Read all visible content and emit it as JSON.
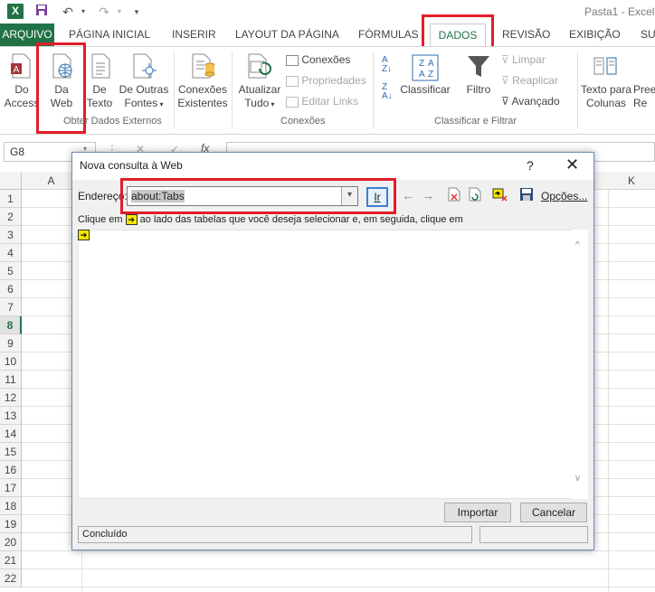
{
  "titlebar": {
    "app_title": "Pasta1 - Excel",
    "qat": [
      "save-icon",
      "undo-icon",
      "redo-icon",
      "customize-qat-icon"
    ]
  },
  "ribbon": {
    "tabs": [
      {
        "id": "arquivo",
        "label": "ARQUIVO"
      },
      {
        "id": "pagina-inicial",
        "label": "PÁGINA INICIAL"
      },
      {
        "id": "inserir",
        "label": "INSERIR"
      },
      {
        "id": "layout",
        "label": "LAYOUT DA PÁGINA"
      },
      {
        "id": "formulas",
        "label": "FÓRMULAS"
      },
      {
        "id": "dados",
        "label": "DADOS"
      },
      {
        "id": "revisao",
        "label": "REVISÃO"
      },
      {
        "id": "exibicao",
        "label": "EXIBIÇÃO"
      },
      {
        "id": "su",
        "label": "SU"
      }
    ],
    "active_tab": "DADOS",
    "groups": {
      "external": {
        "label": "Obter Dados Externos",
        "access": [
          "Do",
          "Access"
        ],
        "web": [
          "Da",
          "Web"
        ],
        "text": [
          "De",
          "Texto"
        ],
        "other": [
          "De Outras",
          "Fontes"
        ]
      },
      "existing": {
        "label": [
          "Conexões",
          "Existentes"
        ]
      },
      "connections": {
        "label": "Conexões",
        "refresh": [
          "Atualizar",
          "Tudo"
        ],
        "items": [
          "Conexões",
          "Propriedades",
          "Editar Links"
        ]
      },
      "sort": {
        "label": "Classificar e Filtrar",
        "sort": "Classificar",
        "filter": "Filtro",
        "items": [
          "Limpar",
          "Reaplicar",
          "Avançado"
        ]
      },
      "tools": {
        "text_cols": [
          "Texto para",
          "Colunas"
        ],
        "pree": [
          "Pree",
          "Re"
        ]
      }
    },
    "accent": "#217346",
    "highlight": "#e11d2a"
  },
  "formula_bar": {
    "name_box": "G8",
    "fx": "fx"
  },
  "grid": {
    "columns": [
      "A",
      "K"
    ],
    "rows": [
      "1",
      "2",
      "3",
      "4",
      "5",
      "6",
      "7",
      "8",
      "9",
      "10",
      "11",
      "12",
      "13",
      "14",
      "15",
      "16",
      "17",
      "18",
      "19",
      "20",
      "21",
      "22"
    ],
    "active_row": "8"
  },
  "dialog": {
    "title": "Nova consulta à Web",
    "help": "?",
    "close": "✕",
    "address_label": "Endereço:",
    "address_value": "about:Tabs",
    "go_button": "Ir",
    "options_button": "Opções...",
    "instruction_before": "Clique em",
    "instruction_after": "ao lado das tabelas que você deseja selecionar e, em seguida, clique em",
    "import_button": "Importar",
    "cancel_button": "Cancelar",
    "status": "Concluído"
  }
}
